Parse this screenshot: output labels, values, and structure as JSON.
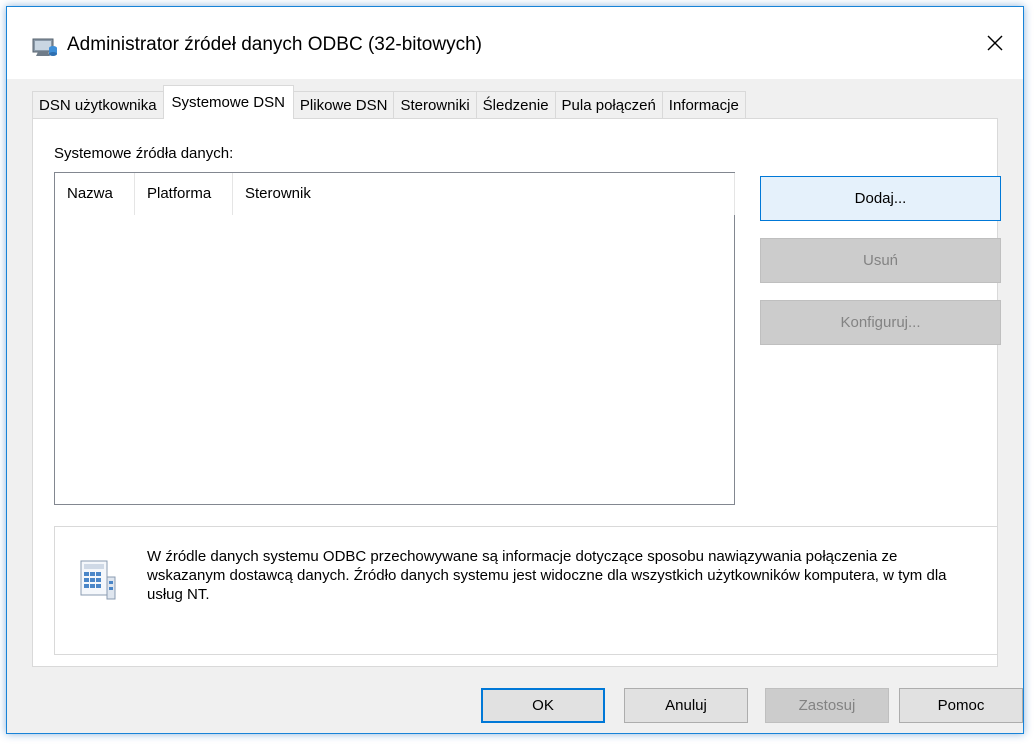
{
  "window": {
    "title": "Administrator źródeł danych ODBC (32-bitowych)",
    "close_symbol": "✕",
    "icon": "odbc-admin-icon"
  },
  "tabs": [
    {
      "label": "DSN użytkownika",
      "active": false
    },
    {
      "label": "Systemowe DSN",
      "active": true
    },
    {
      "label": "Plikowe DSN",
      "active": false
    },
    {
      "label": "Sterowniki",
      "active": false
    },
    {
      "label": "Śledzenie",
      "active": false
    },
    {
      "label": "Pula połączeń",
      "active": false
    },
    {
      "label": "Informacje",
      "active": false
    }
  ],
  "panel": {
    "group_label": "Systemowe źródła danych:",
    "columns": [
      "Nazwa",
      "Platforma",
      "Sterownik"
    ],
    "rows": []
  },
  "side_buttons": {
    "add": "Dodaj...",
    "remove": "Usuń",
    "configure": "Konfiguruj..."
  },
  "info": {
    "text": "W źródle danych systemu ODBC przechowywane są informacje dotyczące sposobu nawiązywania połączenia ze wskazanym dostawcą danych. Źródło danych systemu jest widoczne dla wszystkich użytkowników komputera, w tym dla usług NT.",
    "icon": "data-source-icon"
  },
  "footer": {
    "ok": "OK",
    "cancel": "Anuluj",
    "apply": "Zastosuj",
    "help": "Pomoc"
  },
  "colors": {
    "accent": "#0078d7",
    "dialog_bg": "#f0f0f0",
    "disabled_bg": "#cccccc",
    "disabled_text": "#838383"
  }
}
